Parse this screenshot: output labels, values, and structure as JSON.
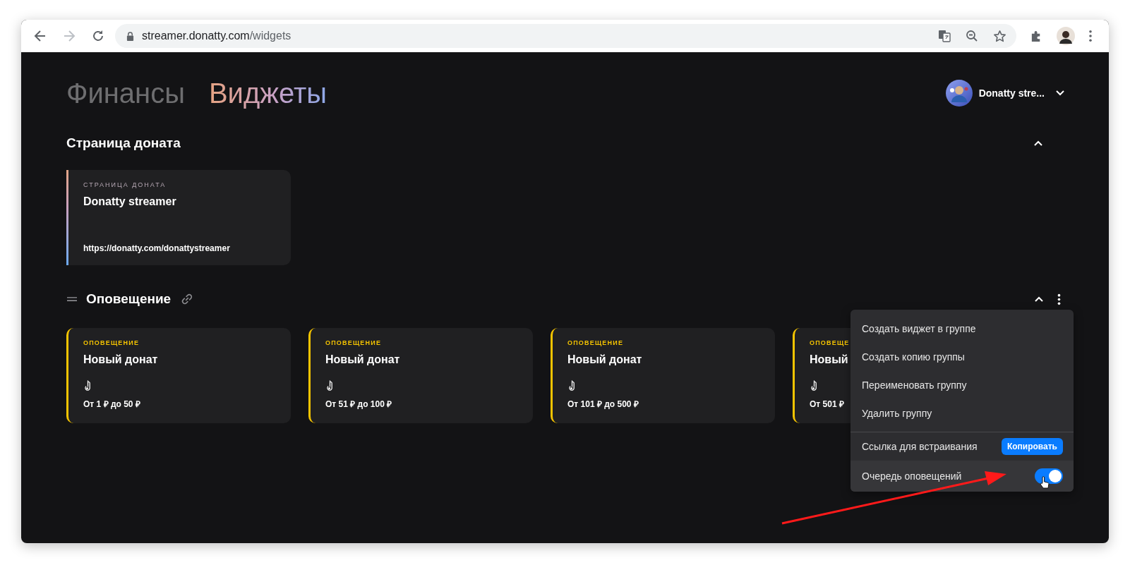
{
  "browser": {
    "url_host": "streamer.donatty.com",
    "url_path": "/widgets"
  },
  "tabs": [
    {
      "label": "Финансы",
      "selected": false
    },
    {
      "label": "Виджеты",
      "selected": true
    }
  ],
  "user": {
    "name": "Donatty stre..."
  },
  "sections": [
    {
      "kind": "page",
      "title": "Страница доната",
      "expanded": true,
      "cards": [
        {
          "kind": "page",
          "label": "СТРАНИЦА ДОНАТА",
          "title": "Donatty streamer",
          "url": "https://donatty.com/donattystreamer"
        }
      ]
    },
    {
      "kind": "group",
      "title": "Оповещение",
      "expanded": true,
      "cards": [
        {
          "kind": "alert",
          "label": "ОПОВЕЩЕНИЕ",
          "title": "Новый донат",
          "range": "От 1 ₽ до 50 ₽"
        },
        {
          "kind": "alert",
          "label": "ОПОВЕЩЕНИЕ",
          "title": "Новый донат",
          "range": "От 51 ₽ до 100 ₽"
        },
        {
          "kind": "alert",
          "label": "ОПОВЕЩЕНИЕ",
          "title": "Новый донат",
          "range": "От 101 ₽ до 500 ₽"
        },
        {
          "kind": "alert",
          "label": "ОПОВЕЩЕ",
          "title": "Новый",
          "range": "От 501 ₽"
        }
      ],
      "menu": [
        {
          "kind": "action",
          "label": "Создать виджет в группе"
        },
        {
          "kind": "action",
          "label": "Создать копию группы"
        },
        {
          "kind": "action",
          "label": "Переименовать группу"
        },
        {
          "kind": "action",
          "label": "Удалить группу"
        },
        {
          "kind": "link",
          "label": "Ссылка для встраивания",
          "button": "Копировать"
        },
        {
          "kind": "toggle",
          "label": "Очередь оповещений",
          "on": true
        }
      ]
    }
  ]
}
